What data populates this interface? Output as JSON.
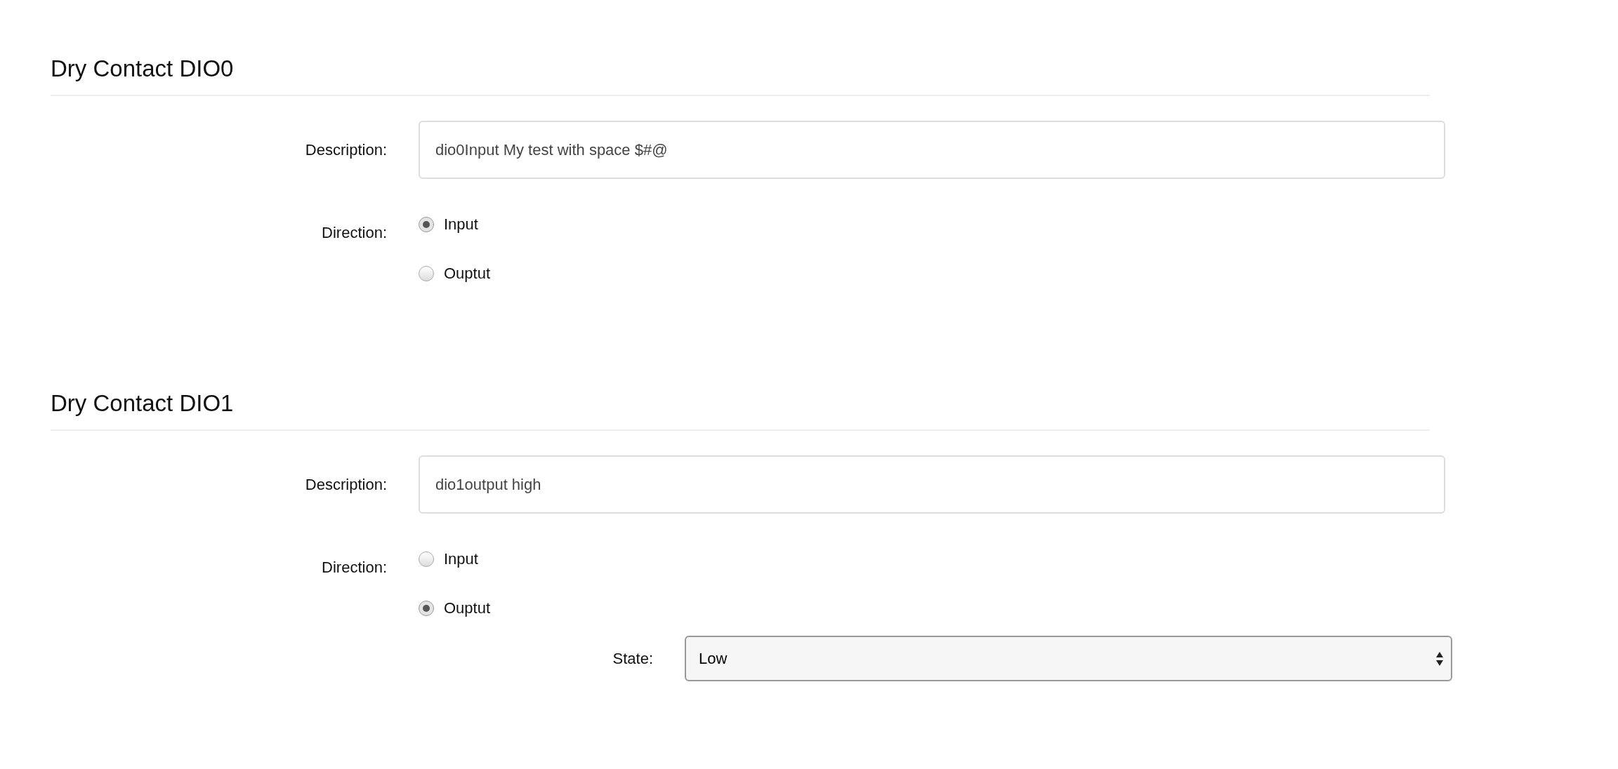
{
  "sections": [
    {
      "title": "Dry Contact DIO0",
      "description": {
        "label": "Description:",
        "value": "dio0Input My test with space $#@"
      },
      "direction": {
        "label": "Direction:",
        "options": [
          {
            "label": "Input",
            "selected": true
          },
          {
            "label": "Ouptut",
            "selected": false
          }
        ]
      }
    },
    {
      "title": "Dry Contact DIO1",
      "description": {
        "label": "Description:",
        "value": "dio1output high"
      },
      "direction": {
        "label": "Direction:",
        "options": [
          {
            "label": "Input",
            "selected": false
          },
          {
            "label": "Ouptut",
            "selected": true
          }
        ]
      },
      "state": {
        "label": "State:",
        "value": "Low"
      }
    }
  ]
}
